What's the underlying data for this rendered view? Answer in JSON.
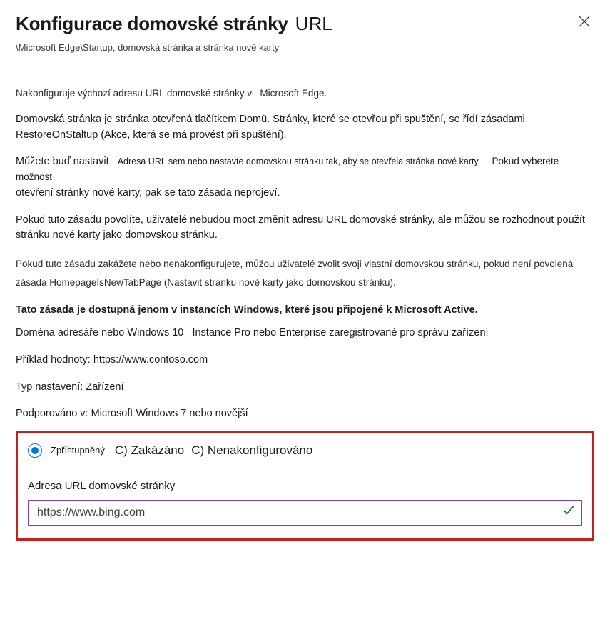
{
  "header": {
    "title_main": "Konfigurace domovské stránky",
    "title_tail": "URL",
    "breadcrumb": "\\Microsoft Edge\\Startup, domovská stránka a stránka nové karty"
  },
  "intro": {
    "line1_a": "Nakonfiguruje výchozí adresu URL domovské stránky v",
    "line1_b": "Microsoft Edge."
  },
  "p1": "Domovská stránka je stránka otevřená tlačítkem Domů. Stránky, které se otevřou při spuštění, se řídí zásadami RestoreOnStaltup (Akce, která se má provést při spuštění).",
  "p2": {
    "a": "Můžete buď nastavit",
    "b": "Adresa URL sem nebo nastavte domovskou stránku tak, aby se otevřela stránka nové karty.",
    "c": "Pokud vyberete možnost",
    "d": "otevření stránky nové karty, pak se tato zásada neprojeví."
  },
  "p3": {
    "a": "Pokud tuto zásadu povolíte, uživatelé nebudou moct změnit adresu URL domovské stránky, ale můžou se rozhodnout použít",
    "b": "stránku nové karty jako domovskou stránku."
  },
  "p4": "Pokud tuto zásadu zakážete nebo nenakonfigurujete, můžou uživatelé zvolit svoji vlastní domovskou stránku, pokud není povolená zásada HomepageIsNewTabPage (Nastavit stránku nové karty jako domovskou stránku).",
  "p5": {
    "a": "Tato zásada je dostupná jenom v instancích Windows, které jsou připojené k Microsoft Active.",
    "b": "Doména adresáře nebo Windows 10",
    "c": "Instance Pro nebo Enterprise zaregistrované pro správu zařízení"
  },
  "example": "Příklad hodnoty: https://www.contoso.com",
  "setting_type": "Typ nastavení: Zařízení",
  "supported": "Podporováno v:  Microsoft Windows 7 nebo novější",
  "radio": {
    "enabled": "Zpřístupněný",
    "disabled": "C) Zakázáno",
    "notconf": "C) Nenakonfigurováno"
  },
  "form": {
    "label": "Adresa URL domovské stránky",
    "value": "https://www.bing.com"
  }
}
